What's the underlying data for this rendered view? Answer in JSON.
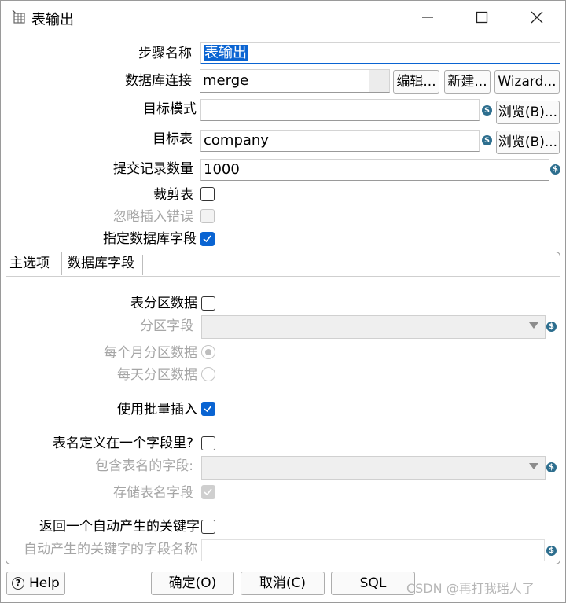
{
  "window": {
    "title": "表输出",
    "minimize_icon": "minimize-icon",
    "maximize_icon": "maximize-icon",
    "close_icon": "close-icon"
  },
  "form": {
    "step_name": {
      "label": "步骤名称",
      "value": "表输出"
    },
    "db_connection": {
      "label": "数据库连接",
      "value": "merge",
      "edit_button": "编辑...",
      "new_button": "新建...",
      "wizard_button": "Wizard..."
    },
    "target_schema": {
      "label": "目标模式",
      "value": "",
      "browse_button": "浏览(B)..."
    },
    "target_table": {
      "label": "目标表",
      "value": "company",
      "browse_button": "浏览(B)..."
    },
    "commit_size": {
      "label": "提交记录数量",
      "value": "1000"
    },
    "truncate_table": {
      "label": "裁剪表",
      "checked": false
    },
    "ignore_insert_errors": {
      "label": "忽略插入错误",
      "checked": false,
      "disabled": true
    },
    "specify_db_fields": {
      "label": "指定数据库字段",
      "checked": true
    }
  },
  "tabs": [
    {
      "label": "主选项",
      "active": true
    },
    {
      "label": "数据库字段",
      "active": false
    }
  ],
  "main_options": {
    "table_partition": {
      "label": "表分区数据",
      "checked": false
    },
    "partition_field": {
      "label": "分区字段",
      "value": ""
    },
    "partition_monthly": {
      "label": "每个月分区数据",
      "selected": true
    },
    "partition_daily": {
      "label": "每天分区数据",
      "selected": false
    },
    "batch_insert": {
      "label": "使用批量插入",
      "checked": true
    },
    "tablename_in_field": {
      "label": "表名定义在一个字段里?",
      "checked": false
    },
    "tablename_field": {
      "label": "包含表名的字段:",
      "value": ""
    },
    "store_tablename_field": {
      "label": "存储表名字段",
      "checked": true
    },
    "return_generated_key": {
      "label": "返回一个自动产生的关键字",
      "checked": false
    },
    "generated_key_field": {
      "label": "自动产生的关键字的字段名称",
      "value": ""
    }
  },
  "footer": {
    "help_button": "Help",
    "ok_button": "确定(O)",
    "cancel_button": "取消(C)",
    "sql_button": "SQL",
    "watermark": "CSDN @再打我瑶人了"
  },
  "colors": {
    "accent": "#0a64d2",
    "variable_icon": "#2d6e8e"
  }
}
